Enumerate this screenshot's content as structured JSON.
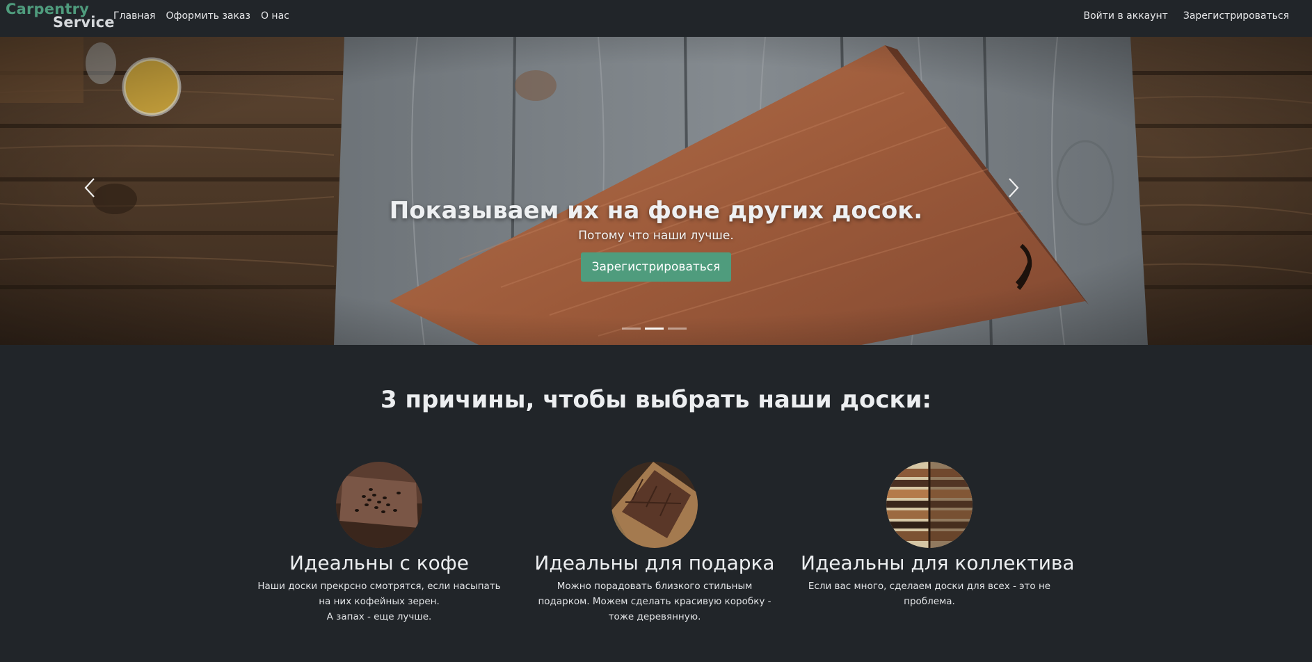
{
  "navbar": {
    "brand_line1": "Carpentry",
    "brand_line2": "Service",
    "links": [
      "Главная",
      "Оформить заказ",
      "О нас"
    ],
    "login": "Войти в аккаунт",
    "register": "Зарегистрироваться"
  },
  "hero": {
    "title": "Показываем их на фоне других досок.",
    "subtitle": "Потому что наши лучше.",
    "button": "Зарегистрироваться",
    "slides_count": 3,
    "active_slide": 2
  },
  "reasons": {
    "heading": "3 причины, чтобы выбрать наши доски:",
    "items": [
      {
        "title": "Идеальны с кофе",
        "text_line1": "Наши доски прекрсно смотрятся, если насыпать на них кофейных зерен.",
        "text_line2": "А запах - еще лучше.",
        "image_icon": "coffee-board-photo"
      },
      {
        "title": "Идеальны для подарка",
        "text_line1": "Можно порадовать близкого стильным подарком. Можем сделать красивую коробку - тоже деревянную.",
        "text_line2": "",
        "image_icon": "gift-box-photo"
      },
      {
        "title": "Идеальны для коллектива",
        "text_line1": "Если вас много, сделаем доски для всех - это не проблема.",
        "text_line2": "",
        "image_icon": "stacked-boards-photo"
      }
    ]
  },
  "colors": {
    "background": "#212529",
    "accent": "#4f9c7d",
    "text": "#eceef0"
  }
}
